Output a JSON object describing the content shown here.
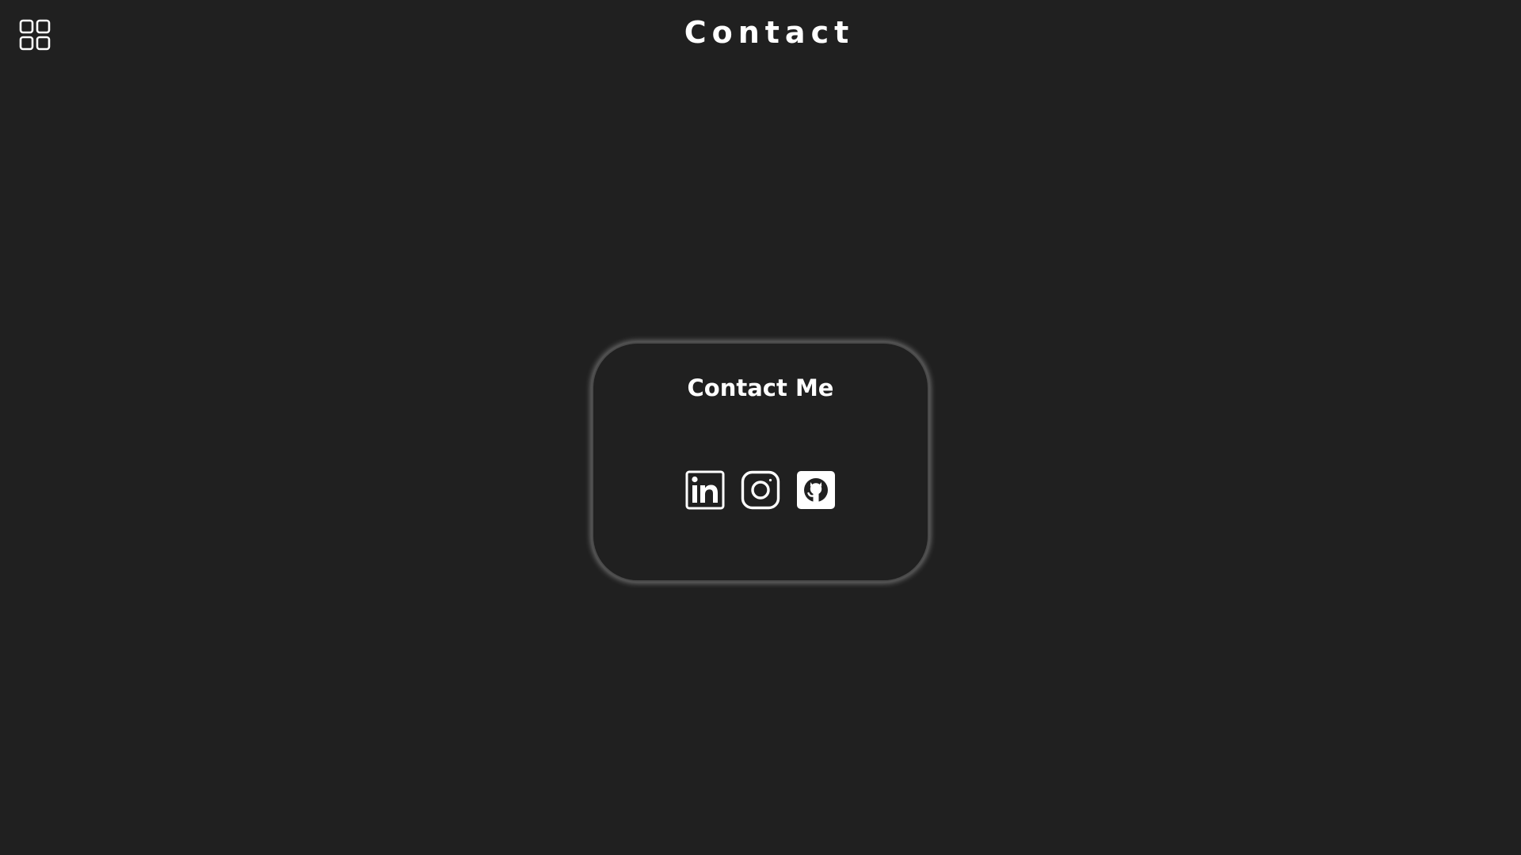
{
  "header": {
    "title": "Contact",
    "menu_icon": "grid-menu-icon"
  },
  "card": {
    "title": "Contact Me",
    "links": [
      {
        "name": "LinkedIn",
        "icon": "linkedin-icon"
      },
      {
        "name": "Instagram",
        "icon": "instagram-icon"
      },
      {
        "name": "GitHub",
        "icon": "github-icon"
      }
    ]
  },
  "colors": {
    "background": "#202020",
    "foreground": "#ffffff",
    "card_border": "#4a4a4a"
  }
}
